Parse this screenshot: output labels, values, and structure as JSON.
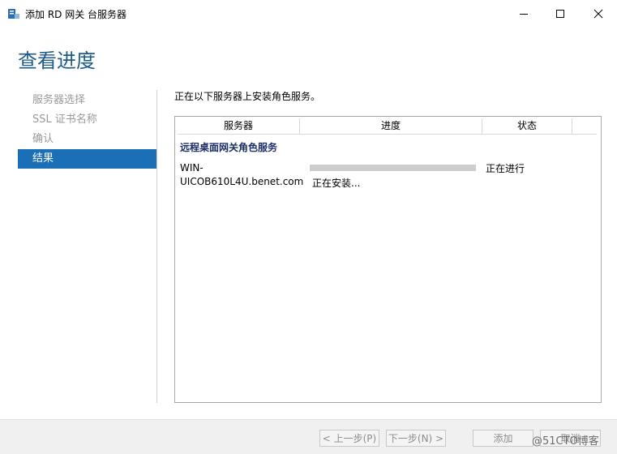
{
  "window": {
    "title": "添加 RD 网关 台服务器"
  },
  "page": {
    "title": "查看进度"
  },
  "nav": {
    "items": [
      {
        "label": "服务器选择"
      },
      {
        "label": "SSL 证书名称"
      },
      {
        "label": "确认"
      },
      {
        "label": "结果"
      }
    ],
    "active_index": 3
  },
  "content": {
    "intro": "正在以下服务器上安装角色服务。",
    "table": {
      "headers": {
        "server": "服务器",
        "progress": "进度",
        "status": "状态"
      },
      "group_label": "远程桌面网关角色服务",
      "row": {
        "server_line1": "WIN-",
        "server_line2": "UICOB610L4U.benet.com",
        "progress_text": "正在安装...",
        "status": "正在进行"
      }
    }
  },
  "footer": {
    "prev": "< 上一步(P)",
    "next": "下一步(N) >",
    "add": "添加",
    "cancel": "取消",
    "watermark": "@51CTO博客"
  },
  "colors": {
    "accent": "#1a6fb6",
    "title": "#1d5b8a",
    "group_label": "#1c2f66"
  }
}
